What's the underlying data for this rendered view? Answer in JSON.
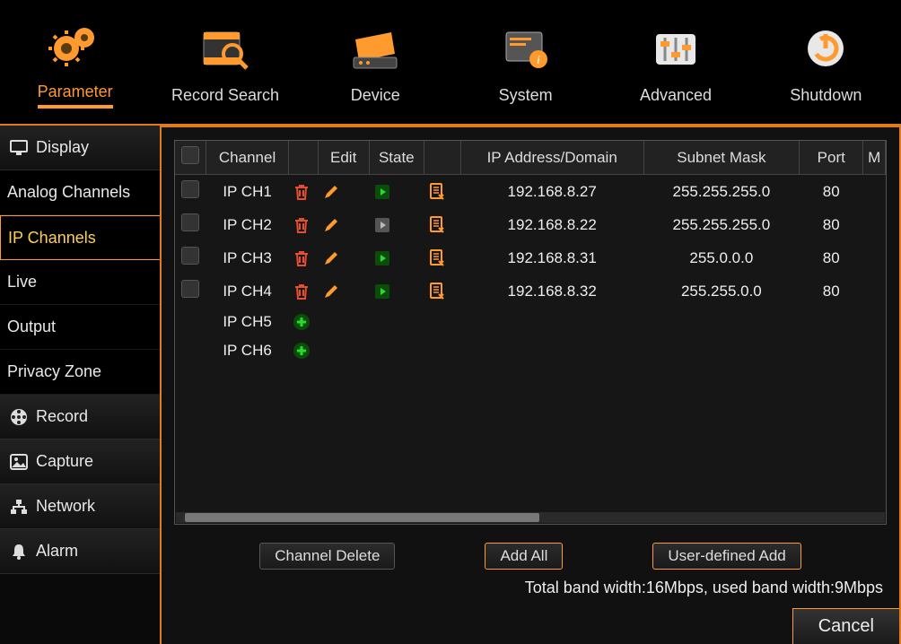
{
  "topnav": [
    {
      "label": "Parameter",
      "icon": "gears",
      "active": true
    },
    {
      "label": "Record Search",
      "icon": "film-search"
    },
    {
      "label": "Device",
      "icon": "hdd"
    },
    {
      "label": "System",
      "icon": "window-info"
    },
    {
      "label": "Advanced",
      "icon": "sliders"
    },
    {
      "label": "Shutdown",
      "icon": "power"
    }
  ],
  "sidebar": [
    {
      "label": "Display",
      "icon": "monitor",
      "type": "head"
    },
    {
      "label": "Analog Channels",
      "type": "sub"
    },
    {
      "label": "IP Channels",
      "type": "sub",
      "active": true
    },
    {
      "label": "Live",
      "type": "sub"
    },
    {
      "label": "Output",
      "type": "sub"
    },
    {
      "label": "Privacy Zone",
      "type": "sub"
    },
    {
      "label": "Record",
      "icon": "reel",
      "type": "head"
    },
    {
      "label": "Capture",
      "icon": "image",
      "type": "head"
    },
    {
      "label": "Network",
      "icon": "network",
      "type": "head"
    },
    {
      "label": "Alarm",
      "icon": "bell",
      "type": "head"
    }
  ],
  "table": {
    "headers": {
      "checkbox": "",
      "channel": "Channel",
      "delete": "",
      "edit": "Edit",
      "state": "State",
      "doc": "",
      "ip": "IP Address/Domain",
      "mask": "Subnet Mask",
      "port": "Port",
      "extra": "M"
    },
    "rows": [
      {
        "channel": "IP CH1",
        "has_delete": true,
        "has_edit": true,
        "state": "play-green",
        "has_doc": true,
        "ip": "192.168.8.27",
        "mask": "255.255.255.0",
        "port": "80"
      },
      {
        "channel": "IP CH2",
        "has_delete": true,
        "has_edit": true,
        "state": "play-gray",
        "has_doc": true,
        "ip": "192.168.8.22",
        "mask": "255.255.255.0",
        "port": "80"
      },
      {
        "channel": "IP CH3",
        "has_delete": true,
        "has_edit": true,
        "state": "play-green",
        "has_doc": true,
        "ip": "192.168.8.31",
        "mask": "255.0.0.0",
        "port": "80"
      },
      {
        "channel": "IP CH4",
        "has_delete": true,
        "has_edit": true,
        "state": "play-green",
        "has_doc": true,
        "ip": "192.168.8.32",
        "mask": "255.255.0.0",
        "port": "80"
      },
      {
        "channel": "IP CH5",
        "add": true
      },
      {
        "channel": "IP CH6",
        "add": true
      }
    ]
  },
  "buttons": {
    "channel_delete": "Channel Delete",
    "add_all": "Add All",
    "user_defined_add": "User-defined Add",
    "cancel": "Cancel"
  },
  "bandwidth": "Total band width:16Mbps, used band width:9Mbps"
}
